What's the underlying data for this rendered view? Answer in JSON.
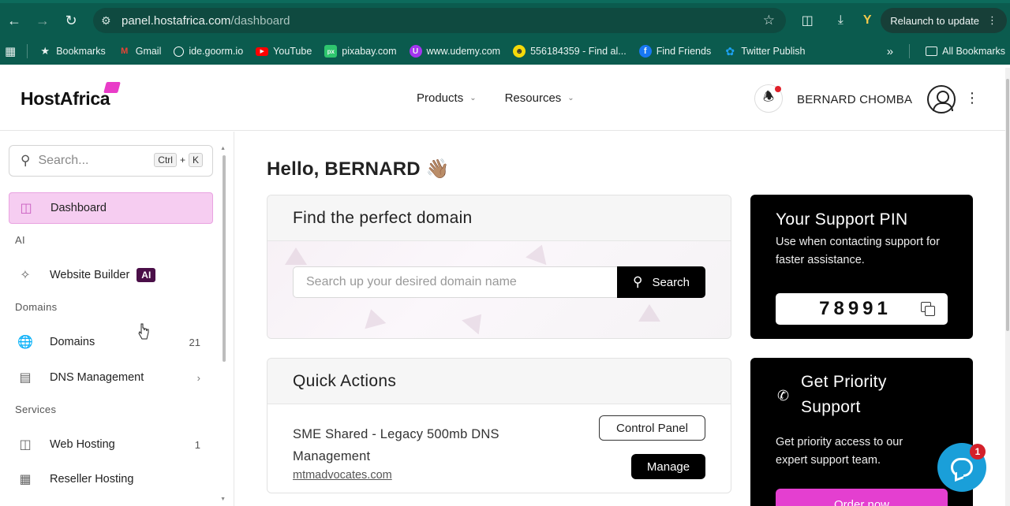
{
  "browser": {
    "url_host": "panel.hostafrica.com",
    "url_path": "/dashboard",
    "relaunch_label": "Relaunch to update",
    "bookmarks": [
      {
        "label": "Bookmarks",
        "icon": "star-icon"
      },
      {
        "label": "Gmail",
        "icon": "gmail-icon"
      },
      {
        "label": "ide.goorm.io",
        "icon": "goorm-icon"
      },
      {
        "label": "YouTube",
        "icon": "youtube-icon"
      },
      {
        "label": "pixabay.com",
        "icon": "pixabay-icon"
      },
      {
        "label": "www.udemy.com",
        "icon": "udemy-icon"
      },
      {
        "label": "556184359 - Find al...",
        "icon": "smile-icon"
      },
      {
        "label": "Find Friends",
        "icon": "facebook-icon"
      },
      {
        "label": "Twitter Publish",
        "icon": "twitter-icon"
      }
    ],
    "all_bookmarks_label": "All Bookmarks"
  },
  "header": {
    "logo": "HostAfrica",
    "nav": [
      {
        "label": "Products"
      },
      {
        "label": "Resources"
      }
    ],
    "username": "BERNARD CHOMBA"
  },
  "sidebar": {
    "search_placeholder": "Search...",
    "shortcut_ctrl": "Ctrl",
    "shortcut_plus": "+",
    "shortcut_key": "K",
    "items": [
      {
        "label": "Dashboard"
      },
      {
        "label": "AI",
        "section": true
      },
      {
        "label": "Website Builder",
        "badge": "AI"
      },
      {
        "label": "Domains",
        "section": true
      },
      {
        "label": "Domains",
        "count": "21"
      },
      {
        "label": "DNS Management"
      },
      {
        "label": "Services",
        "section": true
      },
      {
        "label": "Web Hosting",
        "count": "1"
      },
      {
        "label": "Reseller Hosting"
      }
    ]
  },
  "main": {
    "greeting": "Hello, BERNARD",
    "greeting_emoji": "👋🏽",
    "domain_card": {
      "title": "Find the perfect domain",
      "input_placeholder": "Search up your desired domain name",
      "search_button": "Search"
    },
    "quick_actions": {
      "title": "Quick Actions",
      "service_name": "SME Shared - Legacy 500mb DNS Management",
      "domain_link": "mtmadvocates.com",
      "control_panel_button": "Control Panel",
      "manage_button": "Manage"
    },
    "support_pin": {
      "title": "Your Support PIN",
      "subtitle": "Use when contacting support for faster assistance.",
      "pin": "78991"
    },
    "priority_support": {
      "title": "Get Priority Support",
      "subtitle": "Get priority access to our expert support team.",
      "order_button": "Order now"
    },
    "chat": {
      "badge_count": "1"
    }
  },
  "colors": {
    "browser_bar": "#0b5b4e",
    "accent_pink": "#e43fd0",
    "active_nav_bg": "#f6cdf1",
    "chat_blue": "#1a9fd9"
  }
}
